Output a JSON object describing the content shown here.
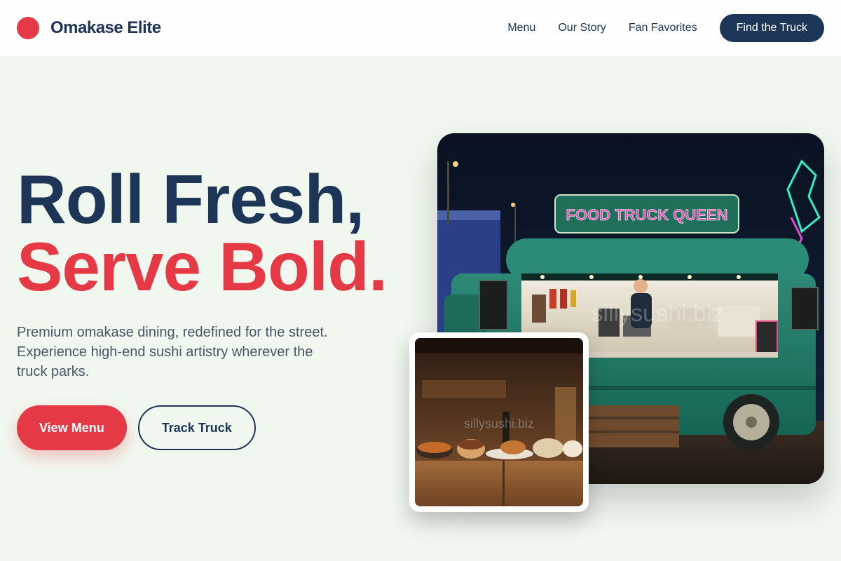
{
  "header": {
    "brand_name": "Omakase Elite",
    "nav": [
      {
        "label": "Menu"
      },
      {
        "label": "Our Story"
      },
      {
        "label": "Fan Favorites"
      }
    ],
    "cta_label": "Find the Truck"
  },
  "hero": {
    "headline_line1": "Roll Fresh,",
    "headline_line2": "Serve Bold.",
    "subtext": "Premium omakase dining, redefined for the street. Experience high-end sushi artistry wherever the truck parks.",
    "primary_button": "View Menu",
    "secondary_button": "Track Truck"
  },
  "images": {
    "main_sign_text": "FOOD TRUCK QUEEN",
    "main_watermark": "sillysushi.biz",
    "inset_watermark": "sillysushi.biz"
  },
  "colors": {
    "navy": "#1d3557",
    "accent_red": "#e63946",
    "background": "#f0f7ef",
    "header_bg": "#fdfefd"
  }
}
